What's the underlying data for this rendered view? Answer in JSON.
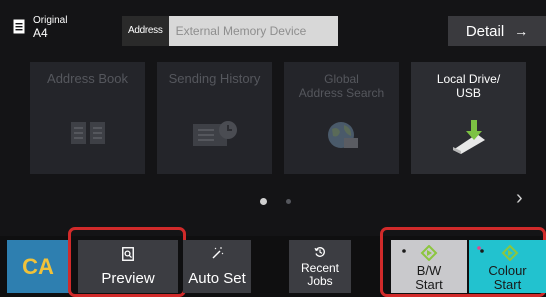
{
  "original": {
    "label": "Original",
    "size": "A4"
  },
  "address": {
    "tag": "Address",
    "value": "External Memory Device"
  },
  "detail": {
    "label": "Detail",
    "arrow": "→"
  },
  "tiles": [
    {
      "label": "Address Book",
      "icon": "address-book-icon",
      "enabled": false
    },
    {
      "label": "Sending History",
      "icon": "sending-history-icon",
      "enabled": false
    },
    {
      "label": "Global\nAddress Search",
      "icon": "globe-icon",
      "enabled": false
    },
    {
      "label": "Local Drive/\nUSB",
      "icon": "usb-drive-icon",
      "enabled": true
    }
  ],
  "pager": {
    "current": 1,
    "total": 2,
    "next": "›"
  },
  "bottom": {
    "clear_all": "CA",
    "preview": "Preview",
    "auto_set": "Auto Set",
    "recent_jobs": "Recent\nJobs",
    "bw_start": "B/W\nStart",
    "colour_start": "Colour\nStart"
  },
  "colors": {
    "clear_all_bg": "#2e7fb0",
    "clear_all_text": "#f0c23a",
    "bw_start_bg": "#c9c9cc",
    "colour_start_bg": "#22c2cf",
    "highlight_outline": "#d12a2a",
    "start_icon_green": "#8cc63f"
  }
}
